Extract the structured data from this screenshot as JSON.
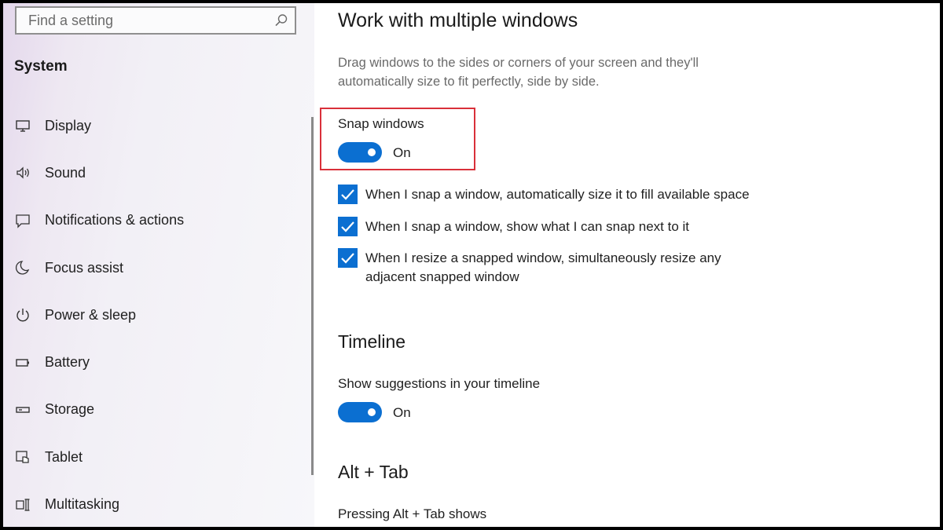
{
  "search": {
    "placeholder": "Find a setting"
  },
  "sidebar": {
    "title": "System",
    "items": [
      {
        "label": "Display",
        "icon": "display-icon"
      },
      {
        "label": "Sound",
        "icon": "sound-icon"
      },
      {
        "label": "Notifications & actions",
        "icon": "notifications-icon"
      },
      {
        "label": "Focus assist",
        "icon": "moon-icon"
      },
      {
        "label": "Power & sleep",
        "icon": "power-icon"
      },
      {
        "label": "Battery",
        "icon": "battery-icon"
      },
      {
        "label": "Storage",
        "icon": "storage-icon"
      },
      {
        "label": "Tablet",
        "icon": "tablet-icon"
      },
      {
        "label": "Multitasking",
        "icon": "multitasking-icon"
      }
    ]
  },
  "main": {
    "multiple_windows": {
      "heading": "Work with multiple windows",
      "description": "Drag windows to the sides or corners of your screen and they'll automatically size to fit perfectly, side by side.",
      "snap_label": "Snap windows",
      "snap_state": "On",
      "checkboxes": [
        {
          "label": "When I snap a window, automatically size it to fill available space",
          "checked": true
        },
        {
          "label": "When I snap a window, show what I can snap next to it",
          "checked": true
        },
        {
          "label": "When I resize a snapped window, simultaneously resize any adjacent snapped window",
          "checked": true
        }
      ]
    },
    "timeline": {
      "heading": "Timeline",
      "suggestions_label": "Show suggestions in your timeline",
      "suggestions_state": "On"
    },
    "alt_tab": {
      "heading": "Alt + Tab",
      "label": "Pressing Alt + Tab shows"
    }
  },
  "colors": {
    "accent": "#0b6fd1",
    "highlight": "#d9303a"
  }
}
